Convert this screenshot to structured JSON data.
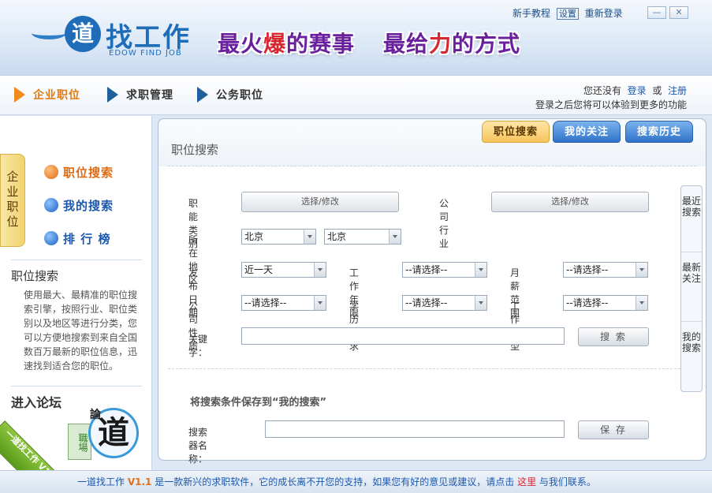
{
  "header": {
    "logo_char": "道",
    "logo_text": "找工作",
    "logo_sub": "EDOW FIND JOB",
    "slogan1_a": "最火",
    "slogan1_hl": "爆",
    "slogan1_b": "的赛事",
    "slogan2_a": "最给",
    "slogan2_hl": "力",
    "slogan2_b": "的方式",
    "links": {
      "guide": "新手教程",
      "settings": "设置",
      "relogin": "重新登录"
    },
    "win": {
      "minimize": "—",
      "close": "✕"
    }
  },
  "nav": {
    "item1": "企业职位",
    "item2": "求职管理",
    "item3": "公务职位"
  },
  "login": {
    "line1_a": "您还没有",
    "login_link": "登录",
    "or": "或",
    "register_link": "注册",
    "line2": "登录之后您将可以体验到更多的功能"
  },
  "sidebar": {
    "vtab": "企业职位",
    "items": [
      "职位搜索",
      "我的搜索",
      "排 行 榜"
    ],
    "section_title": "职位搜索",
    "section_desc": "使用最大、最精准的职位搜索引擎，按照行业、职位类别以及地区等进行分类，您可以方便地搜索到来自全国数百万最新的职位信息，迅速找到适合您的职位。",
    "forum_title": "进入论坛",
    "forum_lun": "論",
    "forum_seal": "職場",
    "forum_char": "道",
    "ribbon": "一道找工作 V1.1"
  },
  "main": {
    "title": "职位搜索",
    "tabs": [
      "职位搜索",
      "我的关注",
      "搜索历史"
    ],
    "labels": {
      "func_cat": "职能类别",
      "industry": "公司行业",
      "region": "所在地区",
      "date": "发布日期",
      "years": "工作年限",
      "salary": "月薪范围",
      "nature": "公司性质",
      "education": "学历要求",
      "jobtype": "工作类型",
      "keyword": "关键字：",
      "search_name": "搜索器名称："
    },
    "pick_btn": "选择/修改",
    "values": {
      "province": "北京",
      "city": "北京",
      "date": "近一天",
      "placeholder": "--请选择--"
    },
    "keyword_value": "",
    "search_btn": "搜 索",
    "save_hint": "将搜索条件保存到“我的搜索”",
    "search_name_value": "",
    "save_btn": "保 存",
    "right_tabs": [
      "最近搜索",
      "最新关注",
      "我的搜索"
    ]
  },
  "footer": {
    "name": "一道找工作",
    "version": "V1.1",
    "text": "是一款新兴的求职软件，它的成长离不开您的支持，如果您有好的意见或建议，请点击",
    "here": "这里",
    "end": "与我们联系。"
  }
}
